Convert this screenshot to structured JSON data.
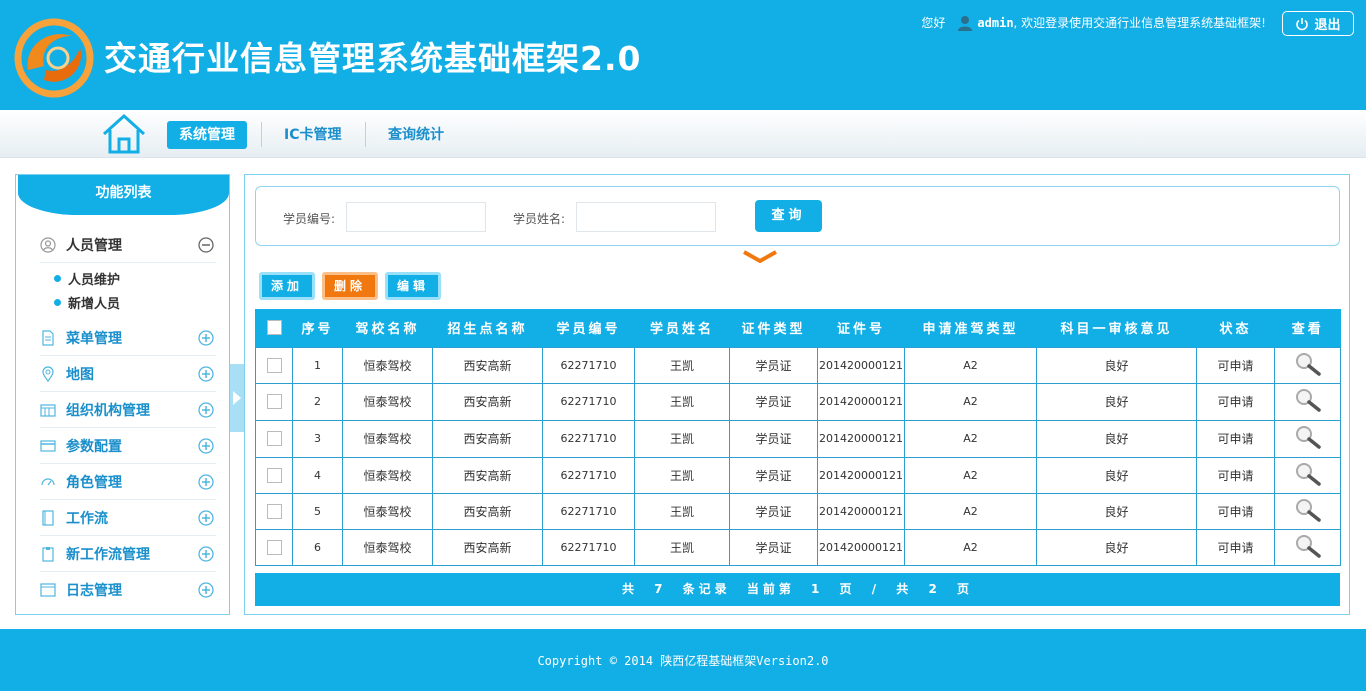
{
  "header": {
    "title": "交通行业信息管理系统基础框架2.0",
    "greeting": "您好",
    "username": "admin",
    "welcome": ", 欢迎登录使用交通行业信息管理系统基础框架!",
    "logout_label": "退出"
  },
  "nav": {
    "tabs": [
      {
        "label": "系统管理",
        "active": true
      },
      {
        "label": "IC卡管理",
        "active": false
      },
      {
        "label": "查询统计",
        "active": false
      }
    ]
  },
  "sidebar": {
    "title": "功能列表",
    "items": [
      {
        "label": "人员管理",
        "icon": "user-circle-icon",
        "open": true
      },
      {
        "label": "菜单管理",
        "icon": "document-icon"
      },
      {
        "label": "地图",
        "icon": "map-pin-icon"
      },
      {
        "label": "组织机构管理",
        "icon": "calendar-grid-icon"
      },
      {
        "label": "参数配置",
        "icon": "card-icon"
      },
      {
        "label": "角色管理",
        "icon": "gauge-icon"
      },
      {
        "label": "工作流",
        "icon": "book-icon"
      },
      {
        "label": "新工作流管理",
        "icon": "clipboard-icon"
      },
      {
        "label": "日志管理",
        "icon": "window-icon"
      }
    ],
    "sub_items": [
      "人员维护",
      "新增人员"
    ]
  },
  "search": {
    "id_label": "学员编号:",
    "id_value": "",
    "name_label": "学员姓名:",
    "name_value": "",
    "button": "查询"
  },
  "toolbar": {
    "add": "添加",
    "delete": "删除",
    "edit": "编辑"
  },
  "table": {
    "columns": [
      "序号",
      "驾校名称",
      "招生点名称",
      "学员编号",
      "学员姓名",
      "证件类型",
      "证件号",
      "申请准驾类型",
      "科目一审核意见",
      "状态",
      "查看"
    ],
    "rows": [
      [
        "1",
        "恒泰驾校",
        "西安高新",
        "62271710",
        "王凯",
        "学员证",
        "201420000121",
        "A2",
        "良好",
        "可申请"
      ],
      [
        "2",
        "恒泰驾校",
        "西安高新",
        "62271710",
        "王凯",
        "学员证",
        "201420000121",
        "A2",
        "良好",
        "可申请"
      ],
      [
        "3",
        "恒泰驾校",
        "西安高新",
        "62271710",
        "王凯",
        "学员证",
        "201420000121",
        "A2",
        "良好",
        "可申请"
      ],
      [
        "4",
        "恒泰驾校",
        "西安高新",
        "62271710",
        "王凯",
        "学员证",
        "201420000121",
        "A2",
        "良好",
        "可申请"
      ],
      [
        "5",
        "恒泰驾校",
        "西安高新",
        "62271710",
        "王凯",
        "学员证",
        "201420000121",
        "A2",
        "良好",
        "可申请"
      ],
      [
        "6",
        "恒泰驾校",
        "西安高新",
        "62271710",
        "王凯",
        "学员证",
        "201420000121",
        "A2",
        "良好",
        "可申请"
      ]
    ]
  },
  "pager": {
    "text": "共 7 条记录 当前第 1 页 / 共 2 页"
  },
  "footer": {
    "copyright": "Copyright © 2014 陕西亿程基础框架Version2.0"
  },
  "colors": {
    "primary": "#12aee6",
    "accent_orange": "#f0780f",
    "link_blue": "#1a8fcc"
  }
}
